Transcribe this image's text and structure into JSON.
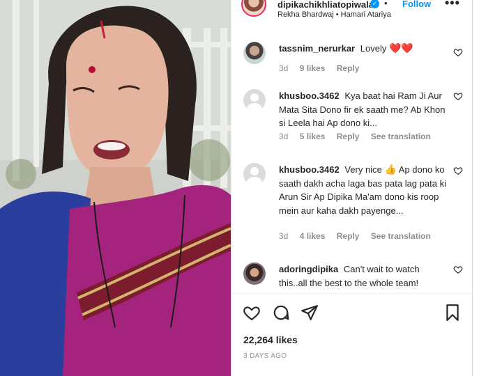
{
  "post": {
    "username": "dipikachikhliatopiwala",
    "verified_icon": "verified-badge-icon",
    "separator": "•",
    "follow_label": "Follow",
    "more_icon": "more-options-icon",
    "audio": "Rekha Bhardwaj • Hamari Atariya"
  },
  "comments": [
    {
      "username": "tassnim_nerurkar",
      "text": "Lovely",
      "emoji": "❤️❤️",
      "age": "3d",
      "likes": "9 likes",
      "reply": "Reply",
      "translate": ""
    },
    {
      "username": "khusboo.3462",
      "text": "Kya baat hai Ram Ji Aur Mata Sita Dono fir ek saath me? Ab Khon si Leela hai Ap dono ki...",
      "age": "3d",
      "likes": "5 likes",
      "reply": "Reply",
      "translate": "See translation"
    },
    {
      "username": "khusboo.3462",
      "text_before": "Very nice",
      "emoji": "👍",
      "text_after": "Ap dono ko saath dakh acha laga bas pata lag pata ki Arun Sir Ap Dipika Ma'am dono kis roop mein aur kaha dakh payenge...",
      "age": "3d",
      "likes": "4 likes",
      "reply": "Reply",
      "translate": "See translation"
    },
    {
      "username": "adoringdipika",
      "text": "Can't wait to watch this..all the best to the whole team!",
      "trailing": "?"
    }
  ],
  "actions": {
    "like_icon": "heart-icon",
    "comment_icon": "comment-icon",
    "share_icon": "share-icon",
    "save_icon": "bookmark-icon"
  },
  "likes_count": "22,264 likes",
  "posted": "3 DAYS AGO",
  "colors": {
    "accent": "#0095f6",
    "text": "#262626",
    "muted": "#8e8e8e",
    "saree": "#a4237d",
    "blouse": "#2a3e9e"
  }
}
